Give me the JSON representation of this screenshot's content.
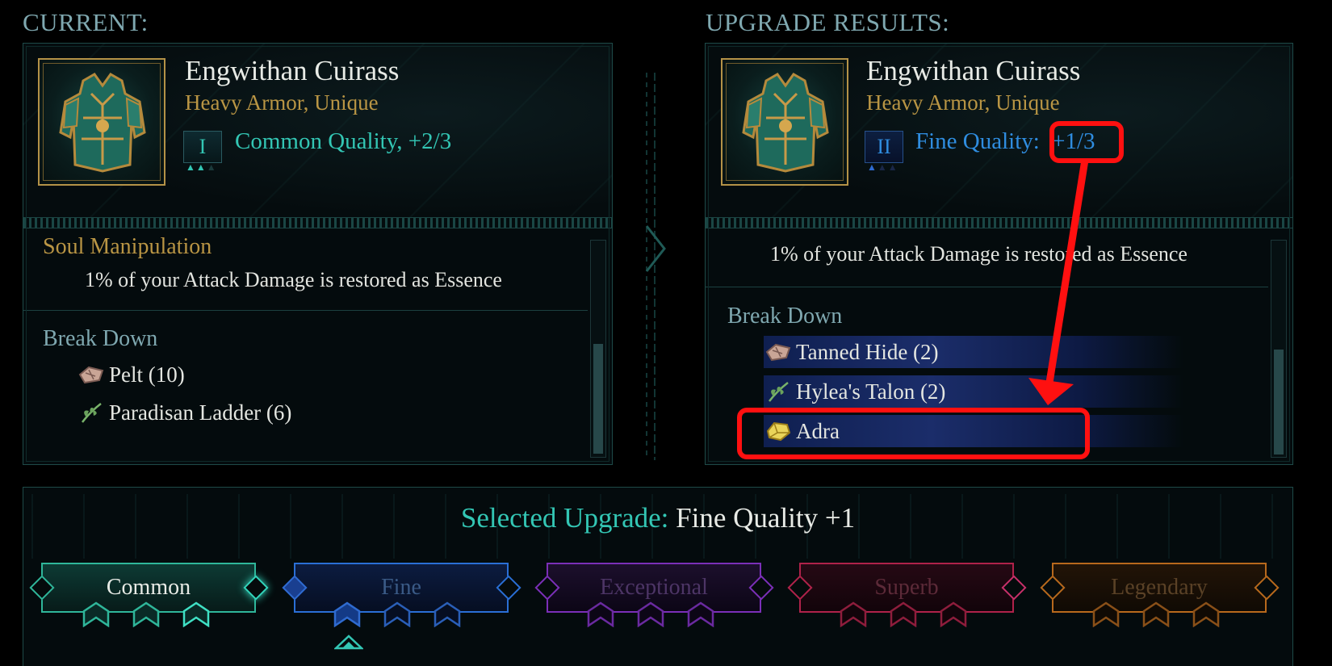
{
  "colors": {
    "teal": "#33c6b4",
    "fine_blue": "#2f8de0",
    "gold": "#b99544",
    "annotation_red": "#ff1010"
  },
  "current": {
    "heading": "CURRENT:",
    "item_name": "Engwithan Cuirass",
    "item_type": "Heavy Armor, Unique",
    "tier_numeral": "I",
    "quality": "Common Quality, +2/3",
    "enchant_title": "Soul Manipulation",
    "enchant_text": "1% of your Attack Damage is restored as Essence",
    "breakdown_title": "Break Down",
    "materials": [
      {
        "icon": "hide-icon",
        "label": "Pelt (10)"
      },
      {
        "icon": "leaf-icon",
        "label": "Paradisan Ladder (6)"
      }
    ]
  },
  "upgrade": {
    "heading": "UPGRADE RESULTS:",
    "item_name": "Engwithan Cuirass",
    "item_type": "Heavy Armor, Unique",
    "tier_numeral": "II",
    "quality_label": "Fine Quality:",
    "quality_value": "+1/3",
    "enchant_text": "1% of your Attack Damage is restored as Essence",
    "breakdown_title": "Break Down",
    "materials": [
      {
        "icon": "hide-icon",
        "label": "Tanned Hide (2)"
      },
      {
        "icon": "leaf-icon",
        "label": "Hylea's Talon (2)"
      },
      {
        "icon": "adra-icon",
        "label": "Adra"
      }
    ]
  },
  "selected": {
    "label": "Selected Upgrade:",
    "value": "Fine Quality +1"
  },
  "tiers": [
    {
      "label": "Common",
      "color": "#2fb69a"
    },
    {
      "label": "Fine",
      "color": "#2a6fd6"
    },
    {
      "label": "Exceptional",
      "color": "#7b2fb8"
    },
    {
      "label": "Superb",
      "color": "#b0224a"
    },
    {
      "label": "Legendary",
      "color": "#b8691c"
    }
  ]
}
